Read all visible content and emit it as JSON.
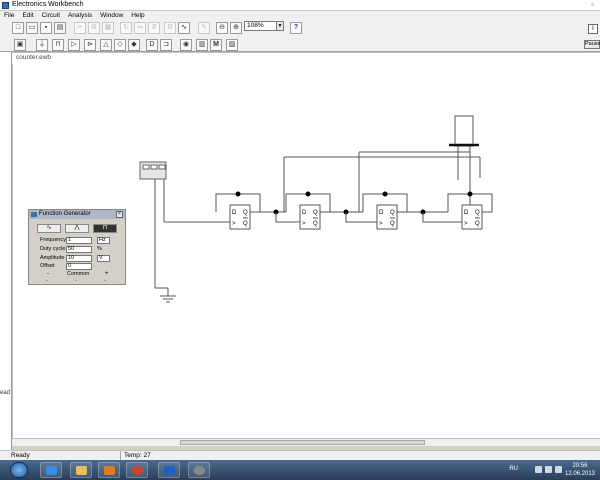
{
  "window": {
    "title": "Electronics Workbench"
  },
  "menu": [
    "File",
    "Edit",
    "Circuit",
    "Analysis",
    "Window",
    "Help"
  ],
  "toolbar": {
    "zoom_value": "108%",
    "help_label": "?",
    "pause_label": "Pause"
  },
  "document": {
    "tab_label": "counter.ewb"
  },
  "function_generator": {
    "title": "Function Generator",
    "frequency_label": "Frequency",
    "frequency_value": "1",
    "frequency_unit": "Hz",
    "duty_label": "Duty cycle",
    "duty_value": "50",
    "duty_unit": "%",
    "amplitude_label": "Amplitude",
    "amplitude_value": "10",
    "amplitude_unit": "V",
    "offset_label": "Offset",
    "offset_value": "0",
    "minus_label": "-",
    "common_label": "Common",
    "plus_label": "+"
  },
  "schematic": {
    "flipflop_pins": {
      "d": "D",
      "q": "Q",
      "clk": ">",
      "qbar": "Q"
    },
    "flipflop_count": 4
  },
  "status": {
    "ready": "Ready",
    "temp": "Temp: 27"
  },
  "side_label": "ead",
  "tray": {
    "lang": "RU",
    "time": "20:56",
    "date": "12.06.2013"
  }
}
